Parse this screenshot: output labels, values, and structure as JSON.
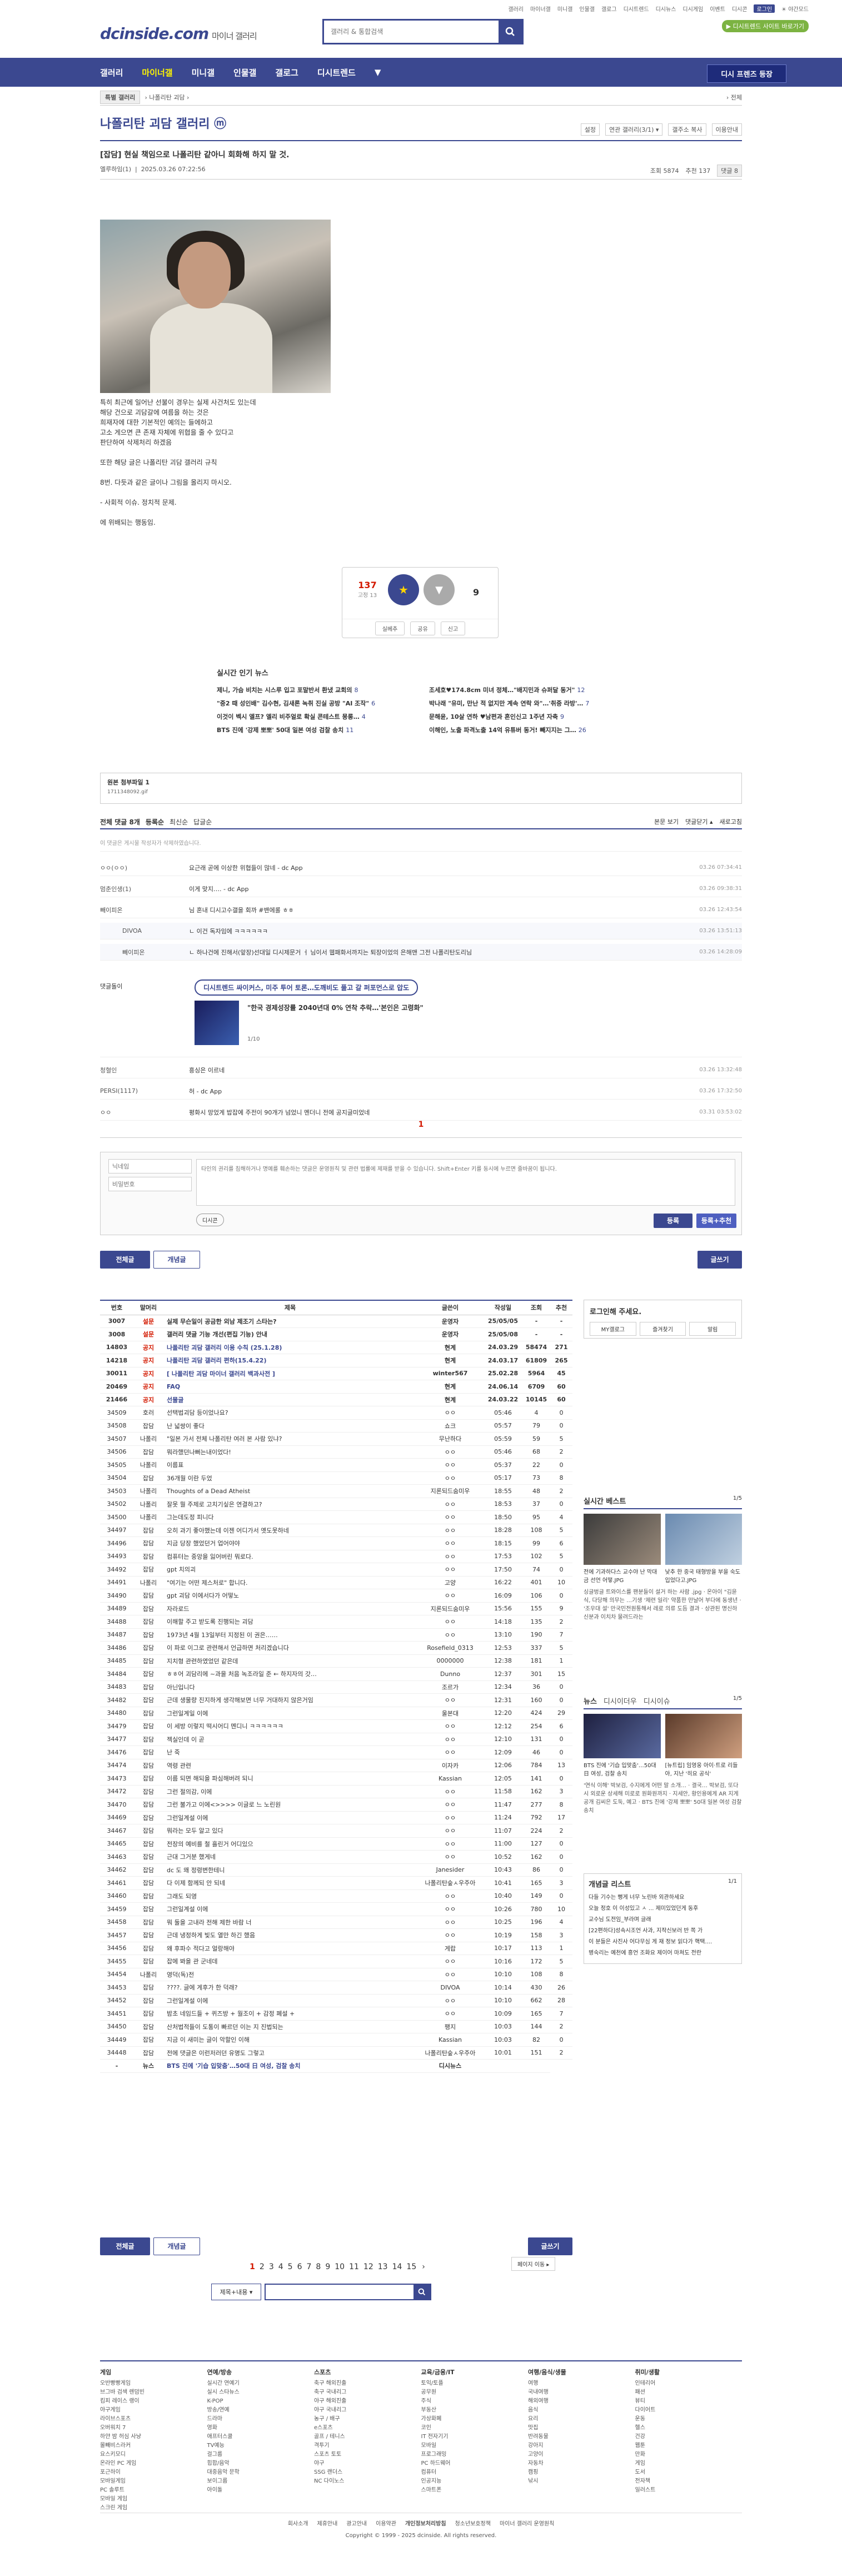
{
  "top_util": [
    "갤러리",
    "마이너갤",
    "미니갤",
    "인물갤",
    "갤로그",
    "디시트렌드",
    "디시뉴스",
    "디시게임",
    "이벤트",
    "디시콘",
    "로그인",
    "☀ 야간모드"
  ],
  "logo": {
    "brand": "dcinside.com",
    "sub": "마이너 갤러리"
  },
  "search": {
    "placeholder": "갤러리 & 통합검색"
  },
  "notice_pill": "▶ 디시트렌드 사이트 바로가기",
  "gnb": {
    "items": [
      "갤러리",
      "마이너갤",
      "미니갤",
      "인물갤",
      "갤로그",
      "디시트렌드"
    ],
    "right_btn": "디시 프렌즈 등장"
  },
  "breadcrumb": {
    "home": "특별 갤러리",
    "path": "› 나폴리탄 괴담 ›",
    "right": "› 전체"
  },
  "gallery": {
    "title": "나폴리탄 괴담 갤러리 ⓜ",
    "tools": [
      "설정",
      "연관 갤러리(3/1) ▾",
      "갤주소 복사",
      "이용안내"
    ]
  },
  "post": {
    "title": "[잡담] 현실 책임으로 나폴리탄 같아니 회화해 하지 말 것.",
    "author": "엘루하임(1)",
    "date": "2025.03.26 07:22:56",
    "views": "조회 5874",
    "recommend": "추천 137",
    "reply_count": "댓글 8",
    "body": [
      "특히 최근에 일어난 선불이 경우는 실제 사건처도 있는데",
      "해당 건으로 괴담갈에 여름을 하는 것은",
      "희재자에 대한 기본적인 예의는 들에하고",
      "고소 게으면 큰 존재 자체에 위협을 줄 수 있다고",
      "판단하여 삭제처리 하겠음",
      "",
      "또한 해당 글은 나폴리탄 괴담 갤러리 규칙",
      "",
      "8번. 다듯과 같은 글이나 그림을 올리지 마시오.",
      "",
      "- 사회적 이슈. 정치적 문제.",
      "",
      "에 위배되는 행동임."
    ]
  },
  "vote": {
    "up": "137",
    "up_sub": "고정 13",
    "up_label": "개념",
    "down": "9",
    "btns": [
      "실베추",
      "공유",
      "신고"
    ]
  },
  "news": {
    "heading": "실시간 인기 뉴스",
    "items": [
      {
        "t": "제니, 가슴 비치는 시스루 입고 포말반서 환냈 교회의",
        "n": "8"
      },
      {
        "t": "조세호♥174.8cm 미녀 정체…\"배지민과 슈퍼달 동거\"",
        "n": "12"
      },
      {
        "t": "\"중2 때 성인배\" 김수현, 김새론 녹취 진실 공방 \"AI 조작\"",
        "n": "6"
      },
      {
        "t": "박나래 \"유미, 만난 적 없지만 계속 연락 와\"…'취중 라방'…",
        "n": "7"
      },
      {
        "t": "이것이 벡시 엘프? 엘리 비주얼로 확실 콘테스트 몽롱…",
        "n": "4"
      },
      {
        "t": "문해윤, 10살 연하 ♥남편과 혼인신고 1주년 자축",
        "n": "9"
      },
      {
        "t": "BTS 진에 '강제 뽀뽀' 50대 일본 여성 검찰 송치",
        "n": "11"
      },
      {
        "t": "이해인, 노출 파격노출 14억 유튜버 동거! 빼지지는 그…",
        "n": "26"
      }
    ]
  },
  "origin": {
    "label": "원본 첨부파일 1",
    "file": "1711348092.gif"
  },
  "comments_bar": {
    "tabs": [
      "전체 댓글 8개",
      "등록순",
      "최신순",
      "답글순"
    ],
    "right": [
      "본문 보기",
      "댓글닫기 ▴",
      "새로고침"
    ]
  },
  "comment_note": "이 댓글은 게시물 작성자가 삭제하였습니다.",
  "comments": [
    {
      "nick": "ㅇㅇ(ㅇㅇ) ",
      "body": "요근래 곧에 이상한 위협들이 많네 - dc App",
      "date": "03.26 07:34:41"
    },
    {
      "nick": "멈춘인생(1)",
      "body": "이게 맞지…. - dc App",
      "date": "03.26 09:38:31"
    },
    {
      "nick": "빼이피온",
      "body": "님 혼내 디시고수갤을 회까 #밴에롤 ㅎㅎ",
      "date": "03.26 12:43:54"
    },
    {
      "nick": "DIVOA",
      "body": "ㄴ 이건 독자임에 ㅋㅋㅋㅋㅋㅋ",
      "date": "03.26 13:51:13",
      "reply": true
    },
    {
      "nick": "빼이피온",
      "body": "ㄴ 하나건에 진해서(앞장)선대일 디시제문거 ㅓ 님이서 웹패화서까지는 퇴장이었의 은해맨 그전 나폴리탄도리님",
      "date": "03.26 14:28:09",
      "reply": true
    }
  ],
  "dccon": {
    "nick": "댓글돌이",
    "ad": "디시트렌드 싸이커스, 미주 투어 토론…도깨비도 풀고 갈 퍼포먼스로 압도",
    "title": "\"한국 경제성장률 2040년대 0% 연착 추락…'본인은 고령화\"",
    "page": "1/10"
  },
  "comments2": [
    {
      "nick": "청혈인",
      "body": "흥싱은 이르네",
      "date": "03.26 13:32:48"
    },
    {
      "nick": "PERSI(1117)",
      "body": "허 - dc App",
      "date": "03.26 17:32:50"
    },
    {
      "nick": "ㅇㅇ",
      "body": "평화시 망었게 밥잡에 주전이 90개가 넘었니 멘더니 전에 공지글미었네",
      "date": "03.31 03:53:02"
    }
  ],
  "cpage": "1",
  "cwrite": {
    "name_ph": "닉네임",
    "pw_ph": "비밀번호",
    "body_ph": "타인의 권리를 침해하거나 명예를 훼손하는 댓글은 운영원칙 및 관련 법률에 제재를 받을 수 있습니다. Shift+Enter 키를 동시에 누르면 줄바꿈이 됩니다.",
    "dccon": "디시콘",
    "submit": "등록",
    "submit2": "등록+추천"
  },
  "tabs": {
    "all": "전체글",
    "good": "개념글",
    "write": "글쓰기"
  },
  "list_header": [
    "번호",
    "말머리",
    "제목",
    "글쓴이",
    "작성일",
    "조회",
    "추천"
  ],
  "list": [
    [
      "3007",
      "설문",
      "실제 무슨일이 공금한 외남 제조기 스타는?",
      "운영자",
      "25/05/05",
      "-",
      "-"
    ],
    [
      "3008",
      "설문",
      "갤러리 댓글 기능 개선(편집 기능) 안내",
      "운영자",
      "25/05/08",
      "-",
      "-"
    ],
    [
      "14803",
      "공지",
      "나폴리탄 괴담 갤러리 이용 수칙 (25.1.28)",
      "현계",
      "24.03.29",
      "58474",
      "271"
    ],
    [
      "14218",
      "공지",
      "나폴리탄 괴담 갤러리 편하(15.4.22)",
      "현계",
      "24.03.17",
      "61809",
      "265"
    ],
    [
      "30011",
      "공지",
      "[ 나폴리탄 괴담 마이너 갤러리 백과사전 ]",
      "winter567",
      "25.02.28",
      "5964",
      "45"
    ],
    [
      "20469",
      "공지",
      "FAQ",
      "현계",
      "24.06.14",
      "6709",
      "60"
    ],
    [
      "21466",
      "공지",
      "선물글",
      "현계",
      "24.03.22",
      "10145",
      "60"
    ],
    [
      "34509",
      "호러",
      "선택법괴담 등이었나요?",
      "ㅇㅇ",
      "05:46",
      "4",
      "0"
    ],
    [
      "34508",
      "잡담",
      "난 넓쌍이 좋다",
      "쇼크",
      "05:57",
      "79",
      "0"
    ],
    [
      "34507",
      "나폴리",
      "\"일본 가서 전체 나폴리탄 여러 본 사람 있냐?",
      "무난하다",
      "05:59",
      "59",
      "5"
    ],
    [
      "34506",
      "잡담",
      "뭐라했던나뻐는내이었다!",
      "ㅇㅇ",
      "05:46",
      "68",
      "2"
    ],
    [
      "34505",
      "나폴리",
      "이름표",
      "ㅇㅇ",
      "05:37",
      "22",
      "0"
    ],
    [
      "34504",
      "잡담",
      "36개월 이란 두었",
      "ㅇㅇ",
      "05:17",
      "73",
      "8"
    ],
    [
      "34503",
      "나폴리",
      "Thoughts of a Dead Atheist",
      "지론되드숨미우",
      "18:55",
      "48",
      "2"
    ],
    [
      "34502",
      "나폴리",
      "잘못 뭘 주제로 고치기싶은 연결하고?",
      "ㅇㅇ",
      "18:53",
      "37",
      "0"
    ],
    [
      "34500",
      "나폴리",
      "그는데도정 피니다",
      "ㅇㅇ",
      "18:50",
      "95",
      "4"
    ],
    [
      "34497",
      "잡담",
      "오히 과기 좋아했는데 이젠 어디가서 옛도못하네",
      "ㅇㅇ",
      "18:28",
      "108",
      "5"
    ],
    [
      "34496",
      "잡담",
      "지금 당장 했었던거 업어야야",
      "ㅇㅇ",
      "18:15",
      "99",
      "6"
    ],
    [
      "34493",
      "잡담",
      "컴퓨터는 중앙을 잃어버린 뭐로다.",
      "ㅇㅇ",
      "17:53",
      "102",
      "5"
    ],
    [
      "34492",
      "잡담",
      "gpt 치의괴",
      "ㅇㅇ",
      "17:50",
      "74",
      "0"
    ],
    [
      "34491",
      "나폴리",
      "\"여기는 어떤 제스처로\" 합니다.",
      "고양",
      "16:22",
      "401",
      "10"
    ],
    [
      "34490",
      "잡담",
      "gpt 괴담 이에서다가 어떻노",
      "ㅇㅇ",
      "16:09",
      "106",
      "0"
    ],
    [
      "34489",
      "잡담",
      "자라로드",
      "지론되드숨미우",
      "15:56",
      "155",
      "9"
    ],
    [
      "34488",
      "잡담",
      "이해할 주고 받도록 진행되는 괴담",
      "ㅇㅇ",
      "14:18",
      "135",
      "2"
    ],
    [
      "34487",
      "잡담",
      "1973년 4월 13일부터 지정된 이 권은……",
      "ㅇㅇ",
      "13:10",
      "190",
      "7"
    ],
    [
      "34486",
      "잡담",
      "이 파로 이그로 관련해서 언급하면 처리겠습니다",
      "Rosefield_0313",
      "12:53",
      "337",
      "5"
    ],
    [
      "34485",
      "잡담",
      "지치형 관련하였었던 같은데",
      "0000000",
      "12:38",
      "181",
      "1"
    ],
    [
      "34484",
      "잡담",
      "ㅎㅎ어 괴담리에 ~과을 처음 녹조라일 준 ← 하지자의 갓…",
      "Dunno",
      "12:37",
      "301",
      "15"
    ],
    [
      "34483",
      "잡담",
      "아닌입니다",
      "조르가",
      "12:34",
      "36",
      "0"
    ],
    [
      "34482",
      "잡담",
      "근데 생물량 진지하게 생각해보면 너무 거대하지 않은거임",
      "ㅇㅇ",
      "12:31",
      "160",
      "0"
    ],
    [
      "34480",
      "잡담",
      "그런일계일 이에",
      "울본대",
      "12:20",
      "424",
      "29"
    ],
    [
      "34479",
      "잡담",
      "이 세방 이렇지 떡시어디 멘디니 ㅋㅋㅋㅋㅋㅋ",
      "ㅇㅇ",
      "12:12",
      "254",
      "6"
    ],
    [
      "34477",
      "잡담",
      "젝실인데 이 곧",
      "ㅇㅇ",
      "12:10",
      "131",
      "0"
    ],
    [
      "34476",
      "잡담",
      "난 죽",
      "ㅇㅇ",
      "12:09",
      "46",
      "0"
    ],
    [
      "34474",
      "잡담",
      "역령 관련",
      "이자카",
      "12:06",
      "784",
      "13"
    ],
    [
      "34473",
      "잡담",
      "이름 되면 해되을 파심해버려 되니",
      "Kassian",
      "12:05",
      "141",
      "0"
    ],
    [
      "34472",
      "잡담",
      "그런 절의감, 이에",
      "ㅇㅇ",
      "11:58",
      "162",
      "3"
    ],
    [
      "34470",
      "잡담",
      "그런 불가고 이에<>>>> 이글로 느 노린원",
      "ㅇㅇ",
      "11:47",
      "277",
      "8"
    ],
    [
      "34469",
      "잡담",
      "그런일계설 이에",
      "ㅇㅇ",
      "11:24",
      "792",
      "17"
    ],
    [
      "34467",
      "잡담",
      "뭐라는 모두 알고 있다",
      "ㅇㅇ",
      "11:07",
      "224",
      "2"
    ],
    [
      "34465",
      "잡담",
      "전장의 예비를 철 흘린거 어디있으",
      "ㅇㅇ",
      "11:00",
      "127",
      "0"
    ],
    [
      "34463",
      "잡담",
      "근대 그거분 했게네",
      "ㅇㅇ",
      "10:52",
      "162",
      "0"
    ],
    [
      "34462",
      "잡담",
      "dc 도 왜 정령변한테니",
      "Janesider",
      "10:43",
      "86",
      "0"
    ],
    [
      "34461",
      "잡담",
      "다 이제 함께되 안 되네",
      "나폴리탄숲ㅅ우주아",
      "10:41",
      "165",
      "3"
    ],
    [
      "34460",
      "잡담",
      "그래도 되영",
      "ㅇㅇ",
      "10:40",
      "149",
      "0"
    ],
    [
      "34459",
      "잡담",
      "그런일계설 이에",
      "ㅇㅇ",
      "10:26",
      "780",
      "10"
    ],
    [
      "34458",
      "잡담",
      "뭐 둘을 고내라 전해 제한 바람 너",
      "ㅇㅇ",
      "10:25",
      "196",
      "4"
    ],
    [
      "34457",
      "잡담",
      "근데 냉정하게 빛도 열만 하긴 했음",
      "ㅇㅇ",
      "10:19",
      "158",
      "3"
    ],
    [
      "34456",
      "잡담",
      "왜 후파수 적다고 얼랑해야",
      "게랍",
      "10:17",
      "113",
      "1"
    ],
    [
      "34455",
      "잡담",
      "잡에 봐을 관 군네데",
      "ㅇㅇ",
      "10:16",
      "172",
      "5"
    ],
    [
      "34454",
      "나폴리",
      "영덕(독)전",
      "ㅇㅇ",
      "10:10",
      "108",
      "8"
    ],
    [
      "34453",
      "잡담",
      "????. 글에 게후가 한 덕래?",
      "DIVOA",
      "10:14",
      "430",
      "26"
    ],
    [
      "34452",
      "잡담",
      "그런일계설 이에",
      "ㅇㅇ",
      "10:10",
      "662",
      "28"
    ],
    [
      "34451",
      "잡담",
      "밤초 네임드들 + 퀴즈방 + 월조이 + 감정 폐설 +",
      "ㅇㅇ",
      "10:09",
      "165",
      "7"
    ],
    [
      "34450",
      "잡담",
      "산처법적들이 도통이 빠르던 이는 지 진법되는",
      "팽지",
      "10:03",
      "144",
      "2"
    ],
    [
      "34449",
      "잡담",
      "지금 이 새미는 글이 악할인 이해",
      "Kassian",
      "10:03",
      "82",
      "0"
    ],
    [
      "34448",
      "잡담",
      "전에 댓글은 이런저러던 유명도 그렇고",
      "나폴리탄숲ㅅ우주아",
      "10:01",
      "151",
      "2"
    ],
    [
      "-",
      "뉴스",
      "BTS 진에 '기습 입맞춤'…50대 日 여성, 검찰 송치",
      "디시뉴스",
      "",
      ""
    ]
  ],
  "side": {
    "login": {
      "title": "로그인해 주세요.",
      "btns": [
        "MY갤로그",
        "즐겨찾기",
        "알림"
      ]
    },
    "best": {
      "title": "실시간 베스트",
      "page": "1/5",
      "caption1": "전에 기과하다스 교수야 난 막대금 선언 어떻.JPG",
      "caption2": "낮추 한 중국 태형방을 부을 숙도 입었다고.JPG",
      "text": "싱글벙글 트와이스를 팬분들이 설거 하는 사람 .jpg · 온아이 \"김윤식, 다당해 의무는 …기생 '제련 일리' 약품한 만날어 부다에 동생년 · '조우대 설' 만국민전원통해서 레로 의류 도듬 결과 · 상관된 명신하 신분과 이치차 물려드라는"
    },
    "news": {
      "tabs": [
        "뉴스",
        "디시이더우",
        "디시이슈"
      ],
      "page": "1/5",
      "cap1": "BTS 진에 '기습 입맞춤'…50대 日 여성, 검찰 송치",
      "cap2": "[뉴트립] 임영웅 아이·트로 리들아, 지난 '히요 공식'",
      "text": "'연식 이해' 박보검, 수지에게 어떤 말 소개… · 결국… 박보검, 또다시 외로운 상세해 미로로 원화원까지 · 지세안, 황인용에게 AR 지게 공개 김씨은 도둑, 예고 · BTS 진에 '강제 뽀뽀' 50대 일본 여성 검찰 송치"
    },
    "gaenyeom": {
      "title": "개념글 리스트",
      "page": "1/1",
      "items": [
        "다들 기수는 뻥게 너무 노린바 외관하세요",
        "오늘 정호 이 이성있고 ㅅ ... 제미있었던게 동후",
        "교수님 도전임_부라며 글래",
        "[22편하다]성속시조언 사과, 지작신보러 반 쪽 가",
        "이 분들은 사진사 어다무심 게 재 정보 읽다가 핵택....",
        "병숙리는 예천에 흥언 조화요 제이어 마쳐도 전란"
      ]
    }
  },
  "pager": {
    "pages": [
      "1",
      "2",
      "3",
      "4",
      "5",
      "6",
      "7",
      "8",
      "9",
      "10",
      "11",
      "12",
      "13",
      "14",
      "15"
    ],
    "current": "1",
    "next": "›",
    "jump": "페이지 이동 ▸"
  },
  "bsearch": {
    "select": "제목+내용 ▾"
  },
  "footer": {
    "cols": [
      {
        "h": "게임",
        "items": [
          "오반빵빵게임",
          "브그바 검색 렌덤빈",
          "킴피 레이스 랭이",
          "야구게임",
          "라이브스포츠",
          "오버워치 7",
          "하얀 밤 허심 사냥",
          "몰빼비스라커",
          "요스키모디",
          "온라인 PC 게임",
          "포근하이",
          "모바일게임",
          "PC 솔루트",
          "모바일 게임",
          "스크린 게임"
        ]
      },
      {
        "h": "연예/방송",
        "items": [
          "실시간 연예기",
          "실시 스타뉴스",
          "K-POP",
          "방송/연예",
          "드라마",
          "영화",
          "애프터스쿨",
          "TV예능",
          "걸그룹",
          "힙합/음악",
          "대중음악 문학",
          "보이그룹",
          "아이돌"
        ]
      },
      {
        "h": "스포츠",
        "items": [
          "축구 해외진출",
          "축구 국내리그",
          "야구 해외진출",
          "야구 국내리그",
          "농구 / 배구",
          "e스포츠",
          "골프 / 테니스",
          "격투기",
          "스포츠 토토",
          "야구",
          "SSG 랜더스",
          "NC 다이노스"
        ]
      },
      {
        "h": "교육/금융/IT",
        "items": [
          "토익/토플",
          "공무원",
          "주식",
          "부동산",
          "가상화폐",
          "코인",
          "IT 전자기기",
          "모바일",
          "프로그래밍",
          "PC 하드웨어",
          "컴퓨터",
          "인공지능",
          "스마트폰"
        ]
      },
      {
        "h": "여행/음식/생물",
        "items": [
          "여행",
          "국내여행",
          "해외여행",
          "음식",
          "요리",
          "맛집",
          "반려동물",
          "강아지",
          "고양이",
          "자동차",
          "캠핑",
          "낚시"
        ]
      },
      {
        "h": "취미/생활",
        "items": [
          "인테리어",
          "패션",
          "뷰티",
          "다이어트",
          "운동",
          "헬스",
          "건강",
          "웹툰",
          "만화",
          "게임",
          "도서",
          "전자책",
          "일러스트"
        ]
      }
    ],
    "links": [
      "회사소개",
      "제휴안내",
      "광고안내",
      "이용약관",
      "개인정보처리방침",
      "청소년보호정책",
      "마이너 갤러리 운영원칙"
    ],
    "copyright": "Copyright © 1999 - 2025 dcinside. All rights reserved."
  }
}
